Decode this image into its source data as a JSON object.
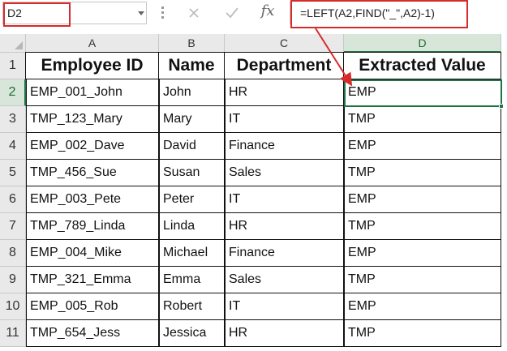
{
  "formula_bar": {
    "name_box": "D2",
    "formula": "=LEFT(A2,FIND(\"_\",A2)-1)",
    "fx_label": "fx"
  },
  "columns": [
    "A",
    "B",
    "C",
    "D"
  ],
  "rows": [
    "1",
    "2",
    "3",
    "4",
    "5",
    "6",
    "7",
    "8",
    "9",
    "10",
    "11"
  ],
  "headers": [
    "Employee ID",
    "Name",
    "Department",
    "Extracted Value"
  ],
  "data": [
    [
      "EMP_001_John",
      "John",
      "HR",
      "EMP"
    ],
    [
      "TMP_123_Mary",
      "Mary",
      "IT",
      "TMP"
    ],
    [
      "EMP_002_Dave",
      "David",
      "Finance",
      "EMP"
    ],
    [
      "TMP_456_Sue",
      "Susan",
      "Sales",
      "TMP"
    ],
    [
      "EMP_003_Pete",
      "Peter",
      "IT",
      "EMP"
    ],
    [
      "TMP_789_Linda",
      "Linda",
      "HR",
      "TMP"
    ],
    [
      "EMP_004_Mike",
      "Michael",
      "Finance",
      "EMP"
    ],
    [
      "TMP_321_Emma",
      "Emma",
      "Sales",
      "TMP"
    ],
    [
      "EMP_005_Rob",
      "Robert",
      "IT",
      "EMP"
    ],
    [
      "TMP_654_Jess",
      "Jessica",
      "HR",
      "TMP"
    ]
  ],
  "active_cell": {
    "column": "D",
    "row": "2"
  },
  "colors": {
    "callout": "#d62b2b",
    "selection": "#217346"
  },
  "icons": [
    "cancel-icon",
    "enter-icon",
    "function-icon",
    "dropdown-arrow-icon"
  ]
}
